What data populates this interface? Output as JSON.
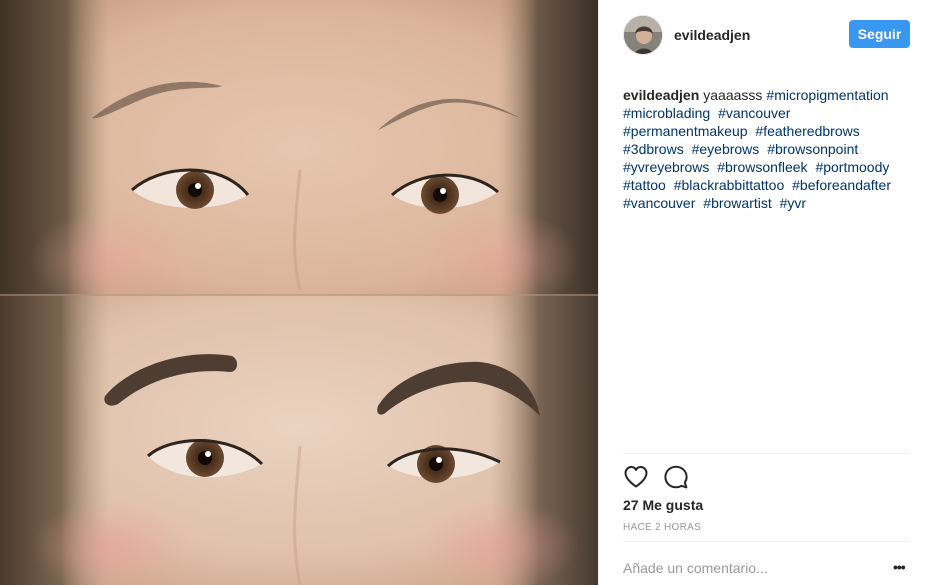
{
  "post": {
    "username": "evildeadjen",
    "follow_label": "Seguir",
    "caption_lead": "yaaaasss",
    "hashtags": [
      "#micropigmentation",
      "#microblading",
      "#vancouver",
      "#permanentmakeup",
      "#featheredbrows",
      "#3dbrows",
      "#eyebrows",
      "#browsonpoint",
      "#yvreyebrows",
      "#browsonfleek",
      "#portmoody",
      "#tattoo",
      "#blackrabbittattoo",
      "#beforeandafter",
      "#vancouver",
      "#browartist",
      "#yvr"
    ],
    "likes": "27 Me gusta",
    "time": "HACE 2 HORAS",
    "comment_placeholder": "Añade un comentario...",
    "more_label": "•••"
  },
  "icons": {
    "like": "heart-icon",
    "comment": "comment-icon",
    "more": "more-options-icon"
  },
  "colors": {
    "follow_button": "#3897f0",
    "hashtag": "#003569",
    "meta_text": "#999999"
  }
}
